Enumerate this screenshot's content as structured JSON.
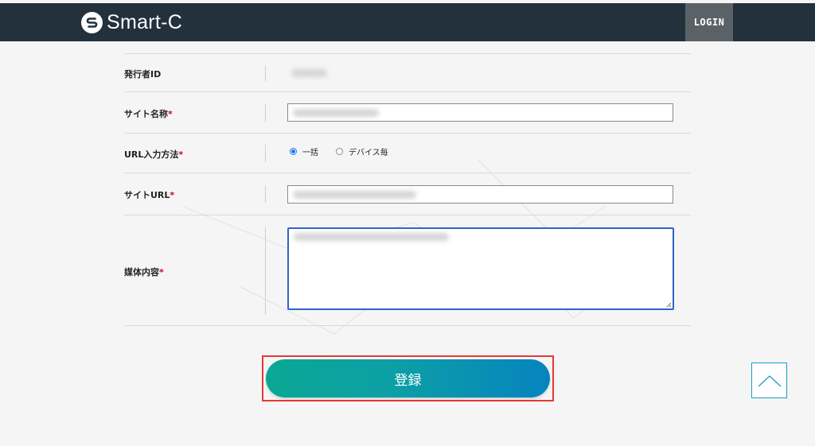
{
  "header": {
    "logo_text": "Smart-C",
    "login_label": "LOGIN"
  },
  "form": {
    "publisher_id_label": "発行者ID",
    "site_name_label": "サイト名称",
    "url_method_label": "URL入力方法",
    "site_url_label": "サイトURL",
    "media_content_label": "媒体内容",
    "required_mark": "*",
    "url_method_options": [
      "一括",
      "デバイス毎"
    ],
    "url_method_selected": "一括"
  },
  "submit": {
    "label": "登録"
  },
  "colors": {
    "header_bg": "#22313c",
    "login_bg": "#5a6268",
    "required": "#d0021b",
    "button_gradient_start": "#0aa894",
    "button_gradient_end": "#0584bf",
    "highlight_frame": "#e53935",
    "textarea_focus": "#2f63c9"
  },
  "icons": {
    "logo": "smart-c-logo-icon",
    "scroll_top": "chevron-up-icon"
  }
}
